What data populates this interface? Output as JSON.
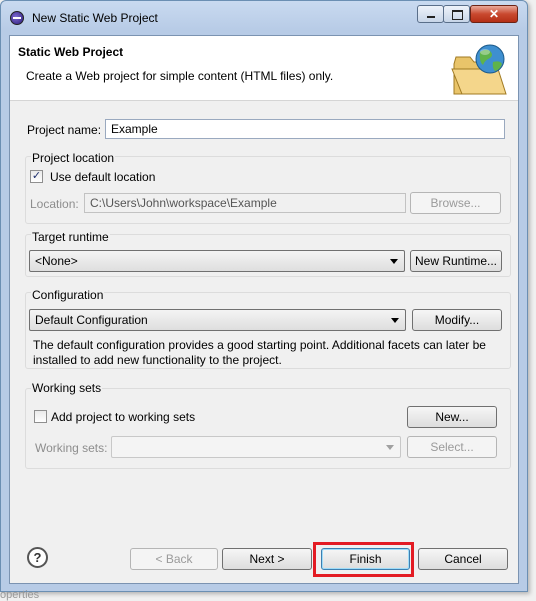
{
  "window": {
    "title": "New Static Web Project"
  },
  "header": {
    "title": "Static Web Project",
    "description": "Create a Web project for simple content (HTML files) only."
  },
  "project": {
    "name_label": "Project name:",
    "name_value": "Example"
  },
  "location": {
    "group_title": "Project location",
    "use_default_label": "Use default location",
    "use_default_checked": true,
    "location_label": "Location:",
    "location_value": "C:\\Users\\John\\workspace\\Example",
    "browse_label": "Browse..."
  },
  "runtime": {
    "group_title": "Target runtime",
    "selected": "<None>",
    "new_runtime_label": "New Runtime..."
  },
  "configuration": {
    "group_title": "Configuration",
    "selected": "Default Configuration",
    "modify_label": "Modify...",
    "description_line1": "The default configuration provides a good starting point. Additional facets can later be",
    "description_line2": "installed to add new functionality to the project."
  },
  "working_sets": {
    "group_title": "Working sets",
    "add_label": "Add project to working sets",
    "add_checked": false,
    "new_label": "New...",
    "sets_label": "Working sets:",
    "sets_value": "",
    "select_label": "Select..."
  },
  "footer": {
    "back_label": "< Back",
    "next_label": "Next >",
    "finish_label": "Finish",
    "cancel_label": "Cancel"
  },
  "underlay_text": "operties",
  "colors": {
    "highlight": "#e31b23",
    "title_gradient": "#b7cbe6"
  },
  "icons": [
    "eclipse-icon",
    "minimize-icon",
    "maximize-icon",
    "close-icon",
    "folder-globe-icon",
    "checkmark-icon",
    "dropdown-arrow-icon",
    "help-icon"
  ]
}
